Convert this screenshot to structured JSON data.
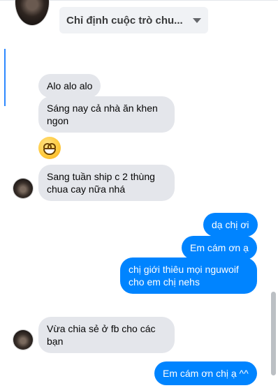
{
  "header": {
    "conversation_selector_label": "Chỉ định cuộc trò chu...",
    "icons": {
      "selector": "chevron-down-icon"
    }
  },
  "colors": {
    "incoming_bubble": "#e4e6eb",
    "outgoing_bubble": "#0084ff",
    "selector_background": "#f0f2f5"
  },
  "messages": {
    "m1": "Alo alo alo",
    "m2": "Sáng nay cả nhà ăn khen ngon",
    "m3": "😁",
    "m4": "Sang tuần ship c 2 thùng chua cay nữa nhá",
    "m5": "dạ chị ơi",
    "m6": "Em cám ơn ạ",
    "m7": "chị giới thiêu mọi nguwoif cho em chị nehs",
    "m8": "Vừa chia sẻ ở fb cho các bạn",
    "m9": "Em cám ơn chị ạ ^^"
  }
}
